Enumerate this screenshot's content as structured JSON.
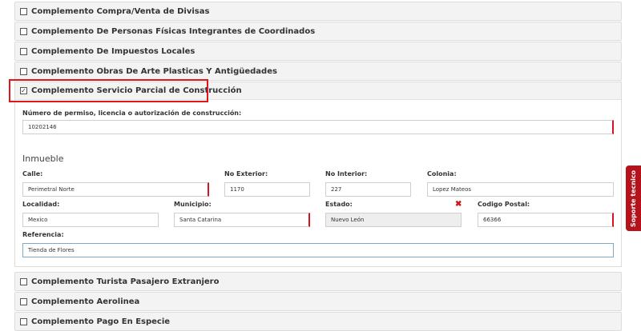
{
  "panels_top": [
    {
      "label": "Complemento Compra/Venta de Divisas"
    },
    {
      "label": "Complemento De Personas Físicas Integrantes de Coordinados"
    },
    {
      "label": "Complemento De Impuestos Locales"
    },
    {
      "label": "Complemento Obras De Arte Plasticas Y Antigüedades"
    }
  ],
  "open_panel": {
    "label": "Complemento Servicio Parcial de Construcción",
    "check_glyph": "✓",
    "permit": {
      "label": "Número de permiso, licencia o autorización de construcción:",
      "value": "10202146"
    },
    "section_title": "Inmueble",
    "fields": {
      "calle": {
        "label": "Calle:",
        "value": "Perimetral Norte"
      },
      "no_exterior": {
        "label": "No Exterior:",
        "value": "1170"
      },
      "no_interior": {
        "label": "No Interior:",
        "value": "227"
      },
      "colonia": {
        "label": "Colonia:",
        "value": "Lopez Mateos"
      },
      "localidad": {
        "label": "Localidad:",
        "value": "Mexico"
      },
      "municipio": {
        "label": "Municipio:",
        "value": "Santa Catarina"
      },
      "estado": {
        "label": "Estado:",
        "value": "Nuevo León"
      },
      "codigo_postal": {
        "label": "Codigo Postal:",
        "value": "66366"
      },
      "referencia": {
        "label": "Referencia:",
        "value": "Tienda de Flores"
      }
    },
    "estado_clear_glyph": "✖"
  },
  "panels_bottom": [
    {
      "label": "Complemento Turista Pasajero Extranjero"
    },
    {
      "label": "Complemento Aerolinea"
    },
    {
      "label": "Complemento Pago En Especie"
    }
  ],
  "support_tab": {
    "label": "Soporte tecnico"
  },
  "colors": {
    "accent_red": "#d4161b",
    "support_bg": "#b5121b",
    "highlight": "#e0161b"
  }
}
